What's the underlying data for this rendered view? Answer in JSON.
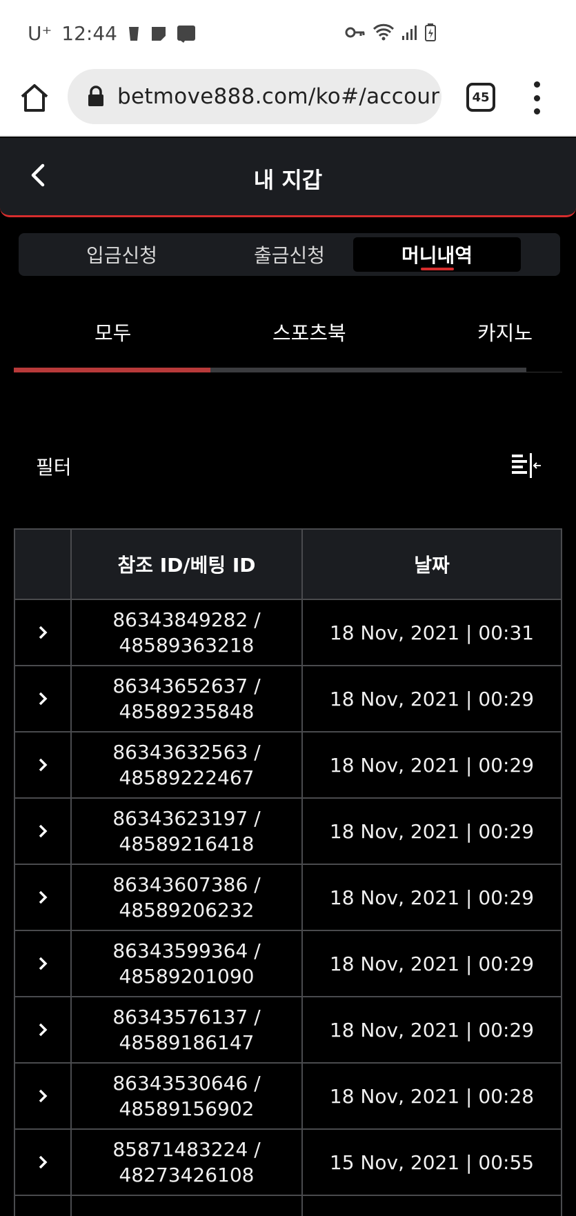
{
  "status_bar": {
    "carrier": "U⁺",
    "time": "12:44"
  },
  "browser": {
    "url": "betmove888.com/ko#/accour",
    "tab_count": "45"
  },
  "header": {
    "title": "내 지갑"
  },
  "segment_tabs": [
    {
      "label": "입금신청",
      "active": false
    },
    {
      "label": "출금신청",
      "active": false
    },
    {
      "label": "머니내역",
      "active": true
    }
  ],
  "category_tabs": [
    {
      "label": "모두",
      "active": true
    },
    {
      "label": "스포츠북",
      "active": false
    },
    {
      "label": "카지노",
      "active": false
    }
  ],
  "filter": {
    "label": "필터"
  },
  "table": {
    "headers": [
      "",
      "참조 ID/베팅 ID",
      "날짜"
    ],
    "rows": [
      {
        "ref_id": "86343849282 /",
        "bet_id": "48589363218",
        "date": "18 Nov, 2021 | 00:31"
      },
      {
        "ref_id": "86343652637 /",
        "bet_id": "48589235848",
        "date": "18 Nov, 2021 | 00:29"
      },
      {
        "ref_id": "86343632563 /",
        "bet_id": "48589222467",
        "date": "18 Nov, 2021 | 00:29"
      },
      {
        "ref_id": "86343623197 /",
        "bet_id": "48589216418",
        "date": "18 Nov, 2021 | 00:29"
      },
      {
        "ref_id": "86343607386 /",
        "bet_id": "48589206232",
        "date": "18 Nov, 2021 | 00:29"
      },
      {
        "ref_id": "86343599364 /",
        "bet_id": "48589201090",
        "date": "18 Nov, 2021 | 00:29"
      },
      {
        "ref_id": "86343576137 /",
        "bet_id": "48589186147",
        "date": "18 Nov, 2021 | 00:29"
      },
      {
        "ref_id": "86343530646 /",
        "bet_id": "48589156902",
        "date": "18 Nov, 2021 | 00:28"
      },
      {
        "ref_id": "85871483224 /",
        "bet_id": "48273426108",
        "date": "15 Nov, 2021 | 00:55"
      }
    ]
  },
  "colors": {
    "accent": "#d62d2d",
    "header_bg": "#1b1d21",
    "border": "#4a4b4e"
  }
}
